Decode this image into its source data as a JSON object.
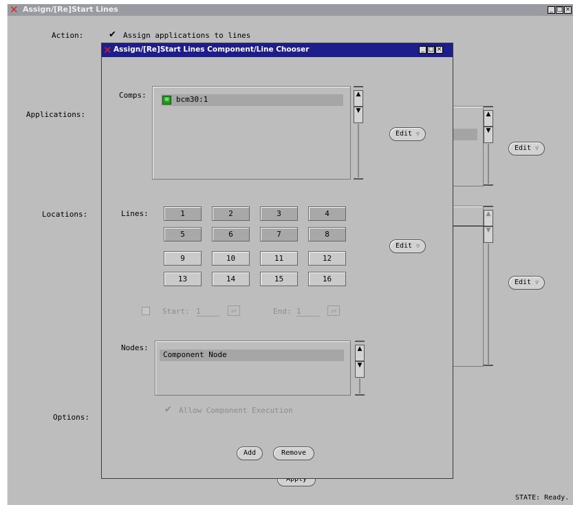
{
  "main_window": {
    "title": "Assign/[Re]Start Lines",
    "controls": [
      "_",
      "□",
      "×"
    ],
    "action_label": "Action:",
    "action_value": "Assign applications to lines",
    "applications_label": "Applications:",
    "locations_label": "Locations:",
    "options_label": "Options:",
    "edit_label": "Edit",
    "apply_label": "Apply",
    "status": "STATE: Ready."
  },
  "dialog": {
    "title": "Assign/[Re]Start Lines Component/Line Chooser",
    "comps_label": "Comps:",
    "comps_items": [
      "bcm30:1"
    ],
    "edit_label": "Edit",
    "lines_label": "Lines:",
    "lines": [
      {
        "label": "1",
        "selected": true
      },
      {
        "label": "2",
        "selected": true
      },
      {
        "label": "3",
        "selected": true
      },
      {
        "label": "4",
        "selected": true
      },
      {
        "label": "5",
        "selected": true
      },
      {
        "label": "6",
        "selected": true
      },
      {
        "label": "7",
        "selected": true
      },
      {
        "label": "8",
        "selected": true
      },
      {
        "label": "9",
        "selected": false
      },
      {
        "label": "10",
        "selected": false
      },
      {
        "label": "11",
        "selected": false
      },
      {
        "label": "12",
        "selected": false
      },
      {
        "label": "13",
        "selected": false
      },
      {
        "label": "14",
        "selected": false
      },
      {
        "label": "15",
        "selected": false
      },
      {
        "label": "16",
        "selected": false
      }
    ],
    "start_label": "Start:",
    "start_value": "1",
    "end_label": "End:",
    "end_value": "1",
    "nodes_label": "Nodes:",
    "nodes_items": [
      "Component Node"
    ],
    "allow_exec_label": "Allow Component Execution",
    "add_label": "Add",
    "remove_label": "Remove"
  },
  "colors": {
    "dialog_title_bg": "#1d1d8c",
    "main_title_bg": "#9a9aa2",
    "panel_bg": "#bdbdbd",
    "x_logo": "#e02020"
  }
}
